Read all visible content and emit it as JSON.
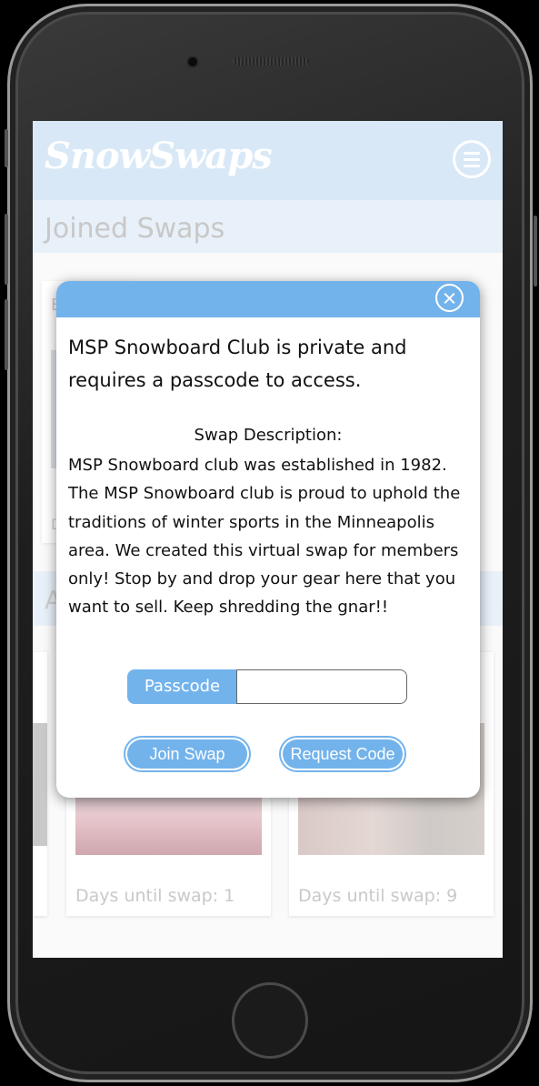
{
  "app": {
    "logo": "SnowSwaps"
  },
  "page": {
    "section_title": "Joined Swaps",
    "joined_card_letter_top": "E",
    "joined_card_letter_bottom": "D",
    "available_section_letter": "A"
  },
  "swap_cards": [
    {
      "days_text": "Days until swap: 1"
    },
    {
      "days_text": "Days until swap: 9"
    }
  ],
  "modal": {
    "title": "MSP Snowboard Club is private and requires a passcode to access.",
    "description_label": "Swap Description:",
    "description": "MSP Snowboard club was established in 1982. The MSP Snowboard club is proud to uphold the traditions of winter sports in the Minneapolis area. We created this virtual swap for members only! Stop by and drop your gear here that you want to sell. Keep shredding the gnar!!",
    "passcode_label": "Passcode",
    "passcode_value": "",
    "join_button": "Join Swap",
    "request_button": "Request Code"
  },
  "colors": {
    "accent": "#73b3ec",
    "header_bg": "#d9e8f6",
    "section_bg": "#e8f0f9"
  }
}
